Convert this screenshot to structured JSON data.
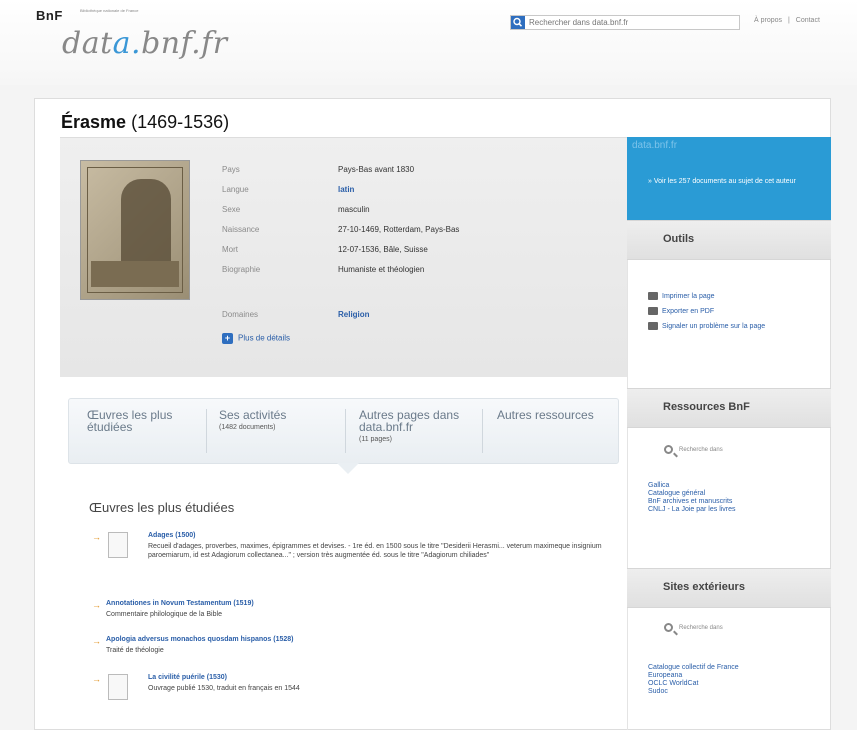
{
  "header": {
    "bnf_logo": "BnF",
    "bnf_logo_sub": "Bibliothèque nationale de France",
    "site_logo_prefix": "dat",
    "site_logo_accent": "a.",
    "site_logo_suffix": "bnf.fr",
    "search_placeholder": "Rechercher dans data.bnf.fr",
    "links": [
      "À propos",
      "Contact"
    ]
  },
  "page": {
    "title_name": "Érasme",
    "title_dates": "(1469-1536)"
  },
  "info": {
    "rows": [
      {
        "label": "Pays",
        "value": "Pays-Bas avant 1830",
        "link": false
      },
      {
        "label": "Langue",
        "value": "latin",
        "link": true
      },
      {
        "label": "Sexe",
        "value": "masculin",
        "link": false
      },
      {
        "label": "Naissance",
        "value": "27-10-1469, Rotterdam, Pays-Bas",
        "link": false
      },
      {
        "label": "Mort",
        "value": "12-07-1536, Bâle, Suisse",
        "link": false
      },
      {
        "label": "Biographie",
        "value": "Humaniste et théologien",
        "link": false
      },
      {
        "label": "Domaines",
        "value": "Religion",
        "link": true
      }
    ],
    "more_details": "Plus de détails"
  },
  "tabs": [
    {
      "label": "Œuvres les plus étudiées",
      "sub": ""
    },
    {
      "label": "Ses activités",
      "sub": "(1482 documents)"
    },
    {
      "label": "Autres pages dans data.bnf.fr",
      "sub": "(11 pages)"
    },
    {
      "label": "Autres ressources",
      "sub": ""
    }
  ],
  "works": {
    "section_title": "Œuvres les plus étudiées",
    "items": [
      {
        "title": "Adages (1500)",
        "desc": "Recueil d'adages, proverbes, maximes, épigrammes et devises. - 1re éd. en 1500 sous le titre \"Desiderii Herasmi... veterum maximeque insignium paroemiarum, id est Adagiorum collectanea...\" ; version très augmentée éd. sous le titre \"Adagiorum chiliades\""
      },
      {
        "title": "Annotationes in Novum Testamentum (1519)",
        "desc": "Commentaire philologique de la Bible"
      },
      {
        "title": "Apologia adversus monachos quosdam hispanos (1528)",
        "desc": "Traité de théologie"
      },
      {
        "title": "La civilité puérile (1530)",
        "desc": "Ouvrage publié 1530, traduit en français en 1544"
      }
    ]
  },
  "sidebar": {
    "blue_title": "data.bnf.fr",
    "blue_link": "» Voir les 257 documents au sujet de cet auteur",
    "tools_title": "Outils",
    "tools": [
      "Imprimer la page",
      "Exporter en PDF",
      "Signaler un problème sur la page"
    ],
    "resources_title": "Ressources BnF",
    "resources_search": "Recherche dans",
    "resources": [
      "Gallica",
      "Catalogue général",
      "BnF archives et manuscrits",
      "CNLJ - La Joie par les livres"
    ],
    "external_title": "Sites extérieurs",
    "external_search": "Recherche dans",
    "external": [
      "Catalogue collectif de France",
      "Europeana",
      "OCLC WorldCat",
      "Sudoc"
    ]
  }
}
